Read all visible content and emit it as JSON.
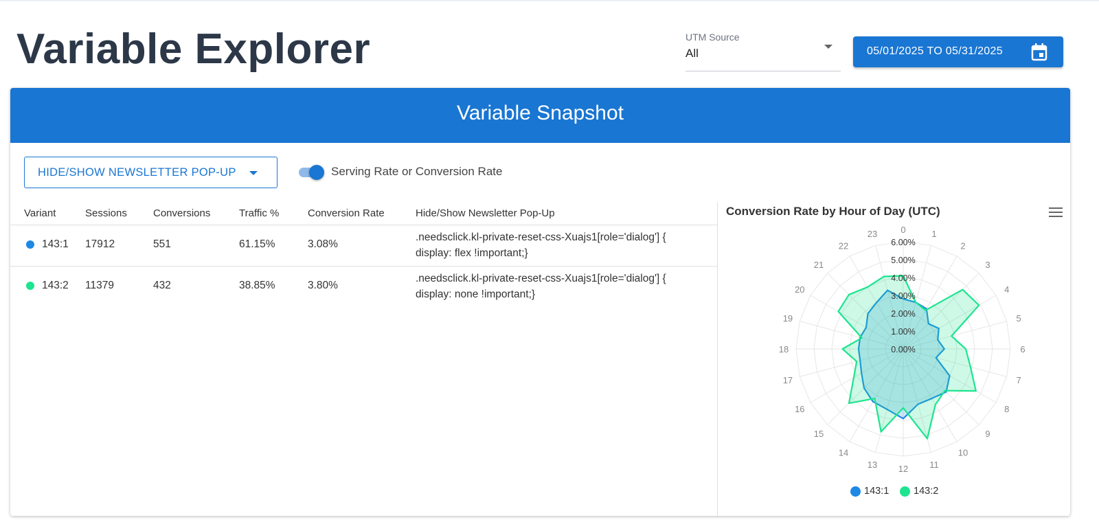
{
  "page": {
    "title": "Variable Explorer"
  },
  "utm_source": {
    "label": "UTM Source",
    "value": "All"
  },
  "date_range": {
    "label": "05/01/2025 TO 05/31/2025"
  },
  "snapshot": {
    "title": "Variable Snapshot",
    "variable_select": "HIDE/SHOW NEWSLETTER POP-UP",
    "toggle_label": "Serving Rate or Conversion Rate",
    "toggle_on": true
  },
  "table": {
    "headers": [
      "Variant",
      "Sessions",
      "Conversions",
      "Traffic %",
      "Conversion Rate",
      "Hide/Show Newsletter Pop-Up"
    ],
    "rows": [
      {
        "variant": "143:1",
        "color": "#1e88e5",
        "sessions": "17912",
        "conversions": "551",
        "traffic": "61.15%",
        "conversion_rate": "3.08%",
        "css_line1": ".needsclick.kl-private-reset-css-Xuajs1[role='dialog'] {",
        "css_line2": "display: flex !important;}"
      },
      {
        "variant": "143:2",
        "color": "#1de48f",
        "sessions": "11379",
        "conversions": "432",
        "traffic": "38.85%",
        "conversion_rate": "3.80%",
        "css_line1": ".needsclick.kl-private-reset-css-Xuajs1[role='dialog'] {",
        "css_line2": "display: none !important;}"
      }
    ]
  },
  "chart_data": {
    "type": "radar",
    "title": "Conversion Rate by Hour of Day (UTC)",
    "categories": [
      "0",
      "1",
      "2",
      "3",
      "4",
      "5",
      "6",
      "7",
      "8",
      "9",
      "10",
      "11",
      "12",
      "13",
      "14",
      "15",
      "16",
      "17",
      "18",
      "19",
      "20",
      "21",
      "22",
      "23"
    ],
    "radial_ticks": [
      "0.00%",
      "1.00%",
      "2.00%",
      "3.00%",
      "4.00%",
      "5.00%",
      "6.00%"
    ],
    "rmax": 6,
    "series": [
      {
        "name": "143:1",
        "color": "#1e88e5",
        "values": [
          2.8,
          2.7,
          2.6,
          2.0,
          2.3,
          2.0,
          2.3,
          1.9,
          3.0,
          3.4,
          3.2,
          3.2,
          3.9,
          3.5,
          3.4,
          3.1,
          2.7,
          2.5,
          2.5,
          2.5,
          2.4,
          2.8,
          3.0,
          3.4
        ]
      },
      {
        "name": "143:2",
        "color": "#1de48f",
        "values": [
          4.1,
          2.7,
          2.5,
          4.7,
          4.9,
          2.8,
          3.5,
          3.9,
          4.7,
          3.3,
          3.6,
          5.2,
          3.3,
          4.8,
          3.2,
          4.3,
          3.2,
          2.7,
          3.4,
          2.4,
          4.2,
          4.3,
          4.0,
          4.2
        ]
      }
    ]
  }
}
